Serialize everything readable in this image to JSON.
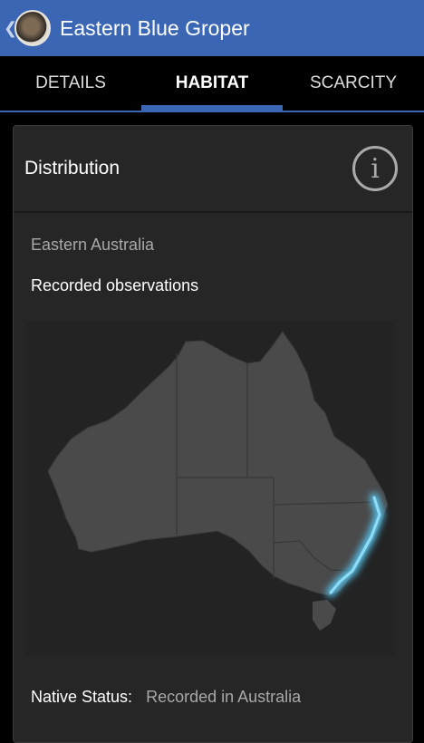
{
  "actionbar": {
    "title": "Eastern Blue Groper",
    "up_icon": "chevron-left-icon",
    "app_icon": "fish-avatar-icon"
  },
  "tabs": [
    {
      "label": "DETAILS",
      "active": false
    },
    {
      "label": "HABITAT",
      "active": true
    },
    {
      "label": "SCARCITY",
      "active": false
    }
  ],
  "card": {
    "title": "Distribution",
    "info_icon": "info-icon",
    "info_glyph": "i",
    "region": "Eastern Australia",
    "observations_label": "Recorded observations",
    "native_status_label": "Native Status:",
    "native_status_value": "Recorded in Australia"
  },
  "colors": {
    "accent": "#3a66b4",
    "card_bg": "#262626",
    "land": "#4a4a4a",
    "highlight": "#57c7f2"
  }
}
